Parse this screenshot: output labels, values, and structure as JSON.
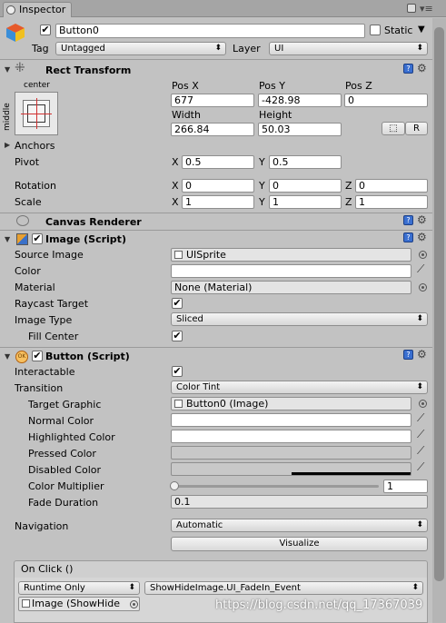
{
  "window": {
    "tab_title": "Inspector"
  },
  "gameobject": {
    "active": true,
    "name": "Button0",
    "static_label": "Static",
    "static_checked": false,
    "tag_label": "Tag",
    "tag_value": "Untagged",
    "layer_label": "Layer",
    "layer_value": "UI"
  },
  "rect_transform": {
    "title": "Rect Transform",
    "anchor_preset_top": "center",
    "anchor_preset_side": "middle",
    "posx_label": "Pos X",
    "posx": "677",
    "posy_label": "Pos Y",
    "posy": "-428.98",
    "posz_label": "Pos Z",
    "posz": "0",
    "width_label": "Width",
    "width": "266.84",
    "height_label": "Height",
    "height": "50.03",
    "r_button": "R",
    "anchors_label": "Anchors",
    "pivot_label": "Pivot",
    "pivot_x": "0.5",
    "pivot_y": "0.5",
    "rotation_label": "Rotation",
    "rot_x": "0",
    "rot_y": "0",
    "rot_z": "0",
    "scale_label": "Scale",
    "scale_x": "1",
    "scale_y": "1",
    "scale_z": "1",
    "axis_x": "X",
    "axis_y": "Y",
    "axis_z": "Z"
  },
  "canvas_renderer": {
    "title": "Canvas Renderer"
  },
  "image": {
    "title": "Image (Script)",
    "enabled": true,
    "source_label": "Source Image",
    "source_value": "UISprite",
    "color_label": "Color",
    "material_label": "Material",
    "material_value": "None (Material)",
    "raycast_label": "Raycast Target",
    "raycast": true,
    "type_label": "Image Type",
    "type_value": "Sliced",
    "fill_label": "Fill Center",
    "fill": true
  },
  "button": {
    "title": "Button (Script)",
    "enabled": true,
    "interactable_label": "Interactable",
    "interactable": true,
    "transition_label": "Transition",
    "transition_value": "Color Tint",
    "target_label": "Target Graphic",
    "target_value": "Button0 (Image)",
    "normal_label": "Normal Color",
    "highlighted_label": "Highlighted Color",
    "pressed_label": "Pressed Color",
    "disabled_label": "Disabled Color",
    "multiplier_label": "Color Multiplier",
    "multiplier_value": "1",
    "fade_label": "Fade Duration",
    "fade_value": "0.1",
    "navigation_label": "Navigation",
    "navigation_value": "Automatic",
    "visualize_button": "Visualize",
    "onclick_title": "On Click ()",
    "runtime_value": "Runtime Only",
    "function_value": "ShowHideImage.UI_FadeIn_Event",
    "object_value": "Image (ShowHide"
  },
  "colors": {
    "panel_bg": "#c2c2c2",
    "pressed_swatch": "#c8c8c8",
    "disabled_swatch": "#c8c8c8"
  },
  "watermark": "https://blog.csdn.net/qq_17367039"
}
